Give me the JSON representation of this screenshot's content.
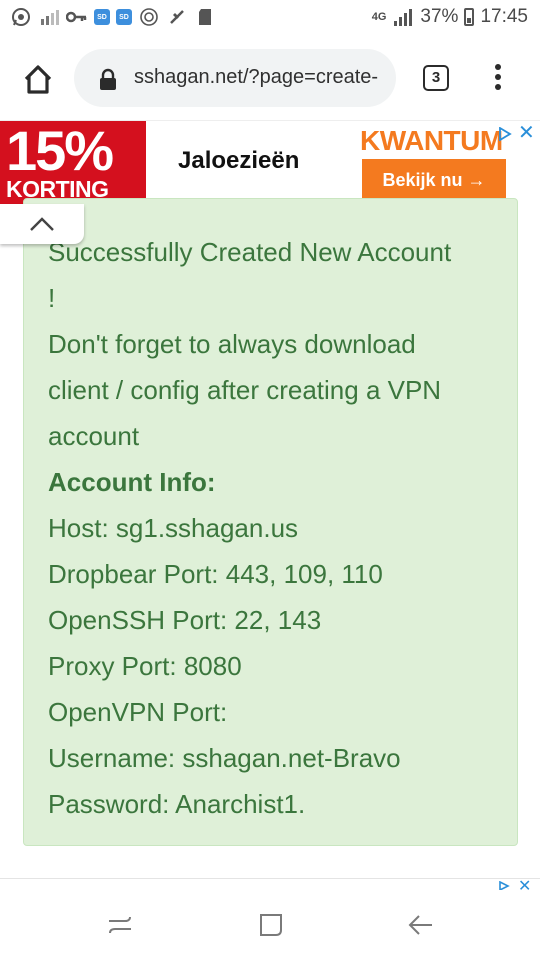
{
  "status_bar": {
    "network": "4G",
    "battery": "37%",
    "time": "17:45",
    "left_icons": [
      "whatsapp-icon",
      "signal-icon",
      "key-icon",
      "sd-card-icon",
      "sd-card-icon",
      "sync-icon",
      "no-data-icon",
      "storage-icon"
    ]
  },
  "browser": {
    "url": "sshagan.net/?page=create-",
    "tab_count": "3"
  },
  "ad": {
    "promo_percent": "15%",
    "promo_word": "KORTING",
    "product": "Jaloezieën",
    "brand": "KWANTUM",
    "cta": "Bekijk nu →",
    "close": "✕"
  },
  "account": {
    "lines": [
      "Successfully Created New Account",
      "!",
      "Don't forget to always download",
      "client / config after creating a VPN",
      "account"
    ],
    "info_heading": "Account Info:",
    "host": "Host: sg1.sshagan.us",
    "dropbear": "Dropbear Port: 443, 109, 110",
    "openssh": "OpenSSH Port: 22, 143",
    "proxy": "Proxy Port: 8080",
    "openvpn": "OpenVPN Port:",
    "username": "Username: sshagan.net-Bravo",
    "password": "Password: Anarchist1."
  },
  "colors": {
    "panel_bg": "#dff0d8",
    "panel_text": "#3b763d",
    "ad_red": "#d4101e",
    "ad_orange": "#f47a1f"
  }
}
